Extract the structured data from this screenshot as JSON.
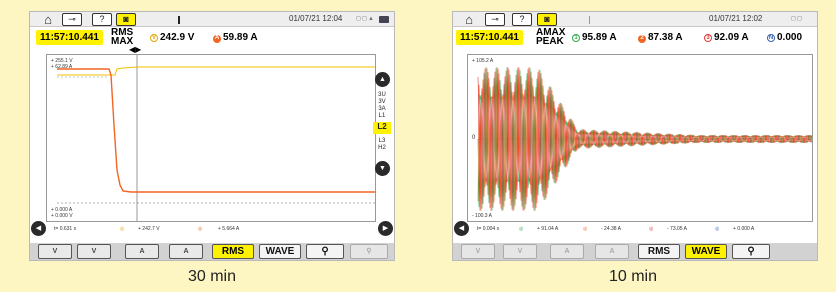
{
  "colors": {
    "accent": "#fff200",
    "page_bg": "#fdf6c3",
    "orange": "#f26522",
    "phase_v": "#e0a800",
    "green": "#2aa84a",
    "red": "#e23a3a",
    "blue": "#3a62b0"
  },
  "panel1": {
    "datetime": "01/07/21 12:04",
    "time": "11:57:10.441",
    "mode_line1": "RMS",
    "mode_line2": "MAX",
    "v_badge": "V",
    "v_value": "242.9 V",
    "a_badge": "A",
    "a_value": "59.89 A",
    "y_top1": "+ 255.1 V",
    "y_top2": "+ 62.89 A",
    "y_bot1": "+ 0.000 A",
    "y_bot2": "+ 0.000 V",
    "side_items": [
      "3U",
      "3V",
      "3A",
      "L1"
    ],
    "side_active": "L2",
    "side_items2": [
      "L3",
      "H2"
    ],
    "legend_t": "t= 0.631 s",
    "legend_v": "+ 242.7 V",
    "legend_a": "+ 5.664 A",
    "tb_v1": "V",
    "tb_v2": "V",
    "tb_a1": "A",
    "tb_a2": "A",
    "tb_rms": "RMS",
    "tb_wave": "WAVE",
    "tb_zoomin": "⚲",
    "tb_zoomout": "⚲",
    "chart_data": {
      "type": "line",
      "x_unit": "s",
      "series": [
        {
          "name": "V",
          "values": [
            255.1,
            242.7,
            242.7,
            242.7,
            242.7
          ]
        },
        {
          "name": "A",
          "values": [
            62.89,
            5.664,
            5.664,
            5.664,
            5.664
          ]
        }
      ]
    }
  },
  "panel2": {
    "datetime": "01/07/21 12:02",
    "time": "11:57:10.441",
    "mode_line1": "AMAX",
    "mode_line2": "PEAK",
    "v1_badge": "1",
    "v1_value": "95.89 A",
    "v2_badge": "2",
    "v2_value": "87.38 A",
    "v3_badge": "3",
    "v3_value": "92.09 A",
    "vn_badge": "N",
    "vn_value": "0.000",
    "y_top": "+ 105.2 A",
    "y_mid": "0",
    "y_bot": "- 100.3 A",
    "legend_t": "t= 0.004 s",
    "legend_1": "+ 91.04 A",
    "legend_2": "- 24.38 A",
    "legend_3": "- 73.05 A",
    "legend_n": "+ 0.000 A",
    "tb_v1": "V",
    "tb_v2": "V",
    "tb_a1": "A",
    "tb_a2": "A",
    "tb_rms": "RMS",
    "tb_wave": "WAVE",
    "tb_zoomin": "⚲"
  },
  "captions": {
    "left": "30 min",
    "right": "10 min"
  }
}
